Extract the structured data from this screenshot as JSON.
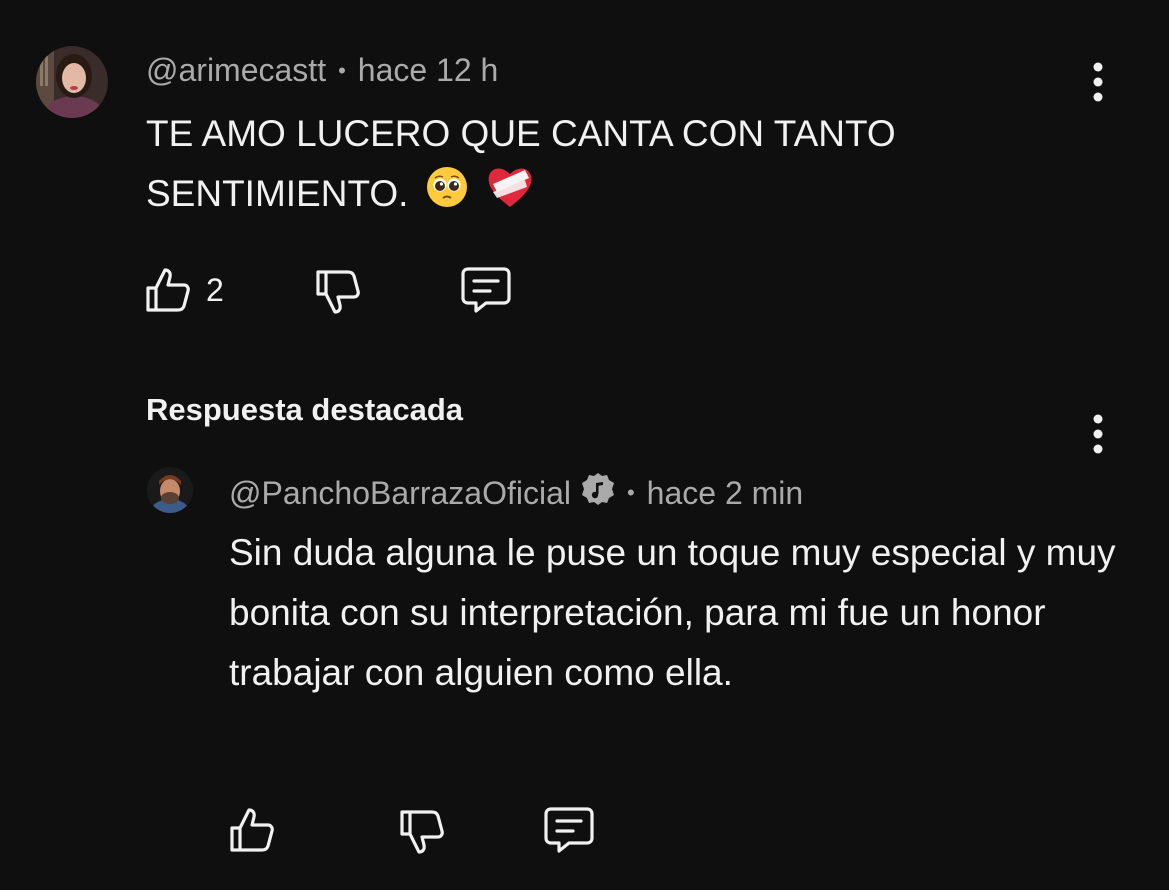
{
  "comment": {
    "author": "@arimecastt",
    "time": "hace 12 h",
    "text": "TE AMO LUCERO QUE CANTA CON TANTO SENTIMIENTO.",
    "emojis": [
      "pleading-face",
      "mending-heart"
    ],
    "likes": "2",
    "icons": {
      "like": "thumbs-up-icon",
      "dislike": "thumbs-down-icon",
      "reply": "comment-icon",
      "more": "more-vertical-icon"
    }
  },
  "replies_section": {
    "title": "Respuesta destacada"
  },
  "reply": {
    "author": "@PanchoBarrazaOficial",
    "verified": "music-note-badge-icon",
    "time": "hace 2 min",
    "text": "Sin duda alguna le puse un toque muy especial y muy bonita con su interpretación, para mi fue un honor trabajar con alguien como ella.",
    "icons": {
      "like": "thumbs-up-icon",
      "dislike": "thumbs-down-icon",
      "reply": "comment-icon",
      "more": "more-vertical-icon"
    }
  },
  "separator": "•",
  "colors": {
    "background": "#0f0f0f",
    "primary_text": "#f1f1f1",
    "secondary_text": "#aaaaaa"
  }
}
